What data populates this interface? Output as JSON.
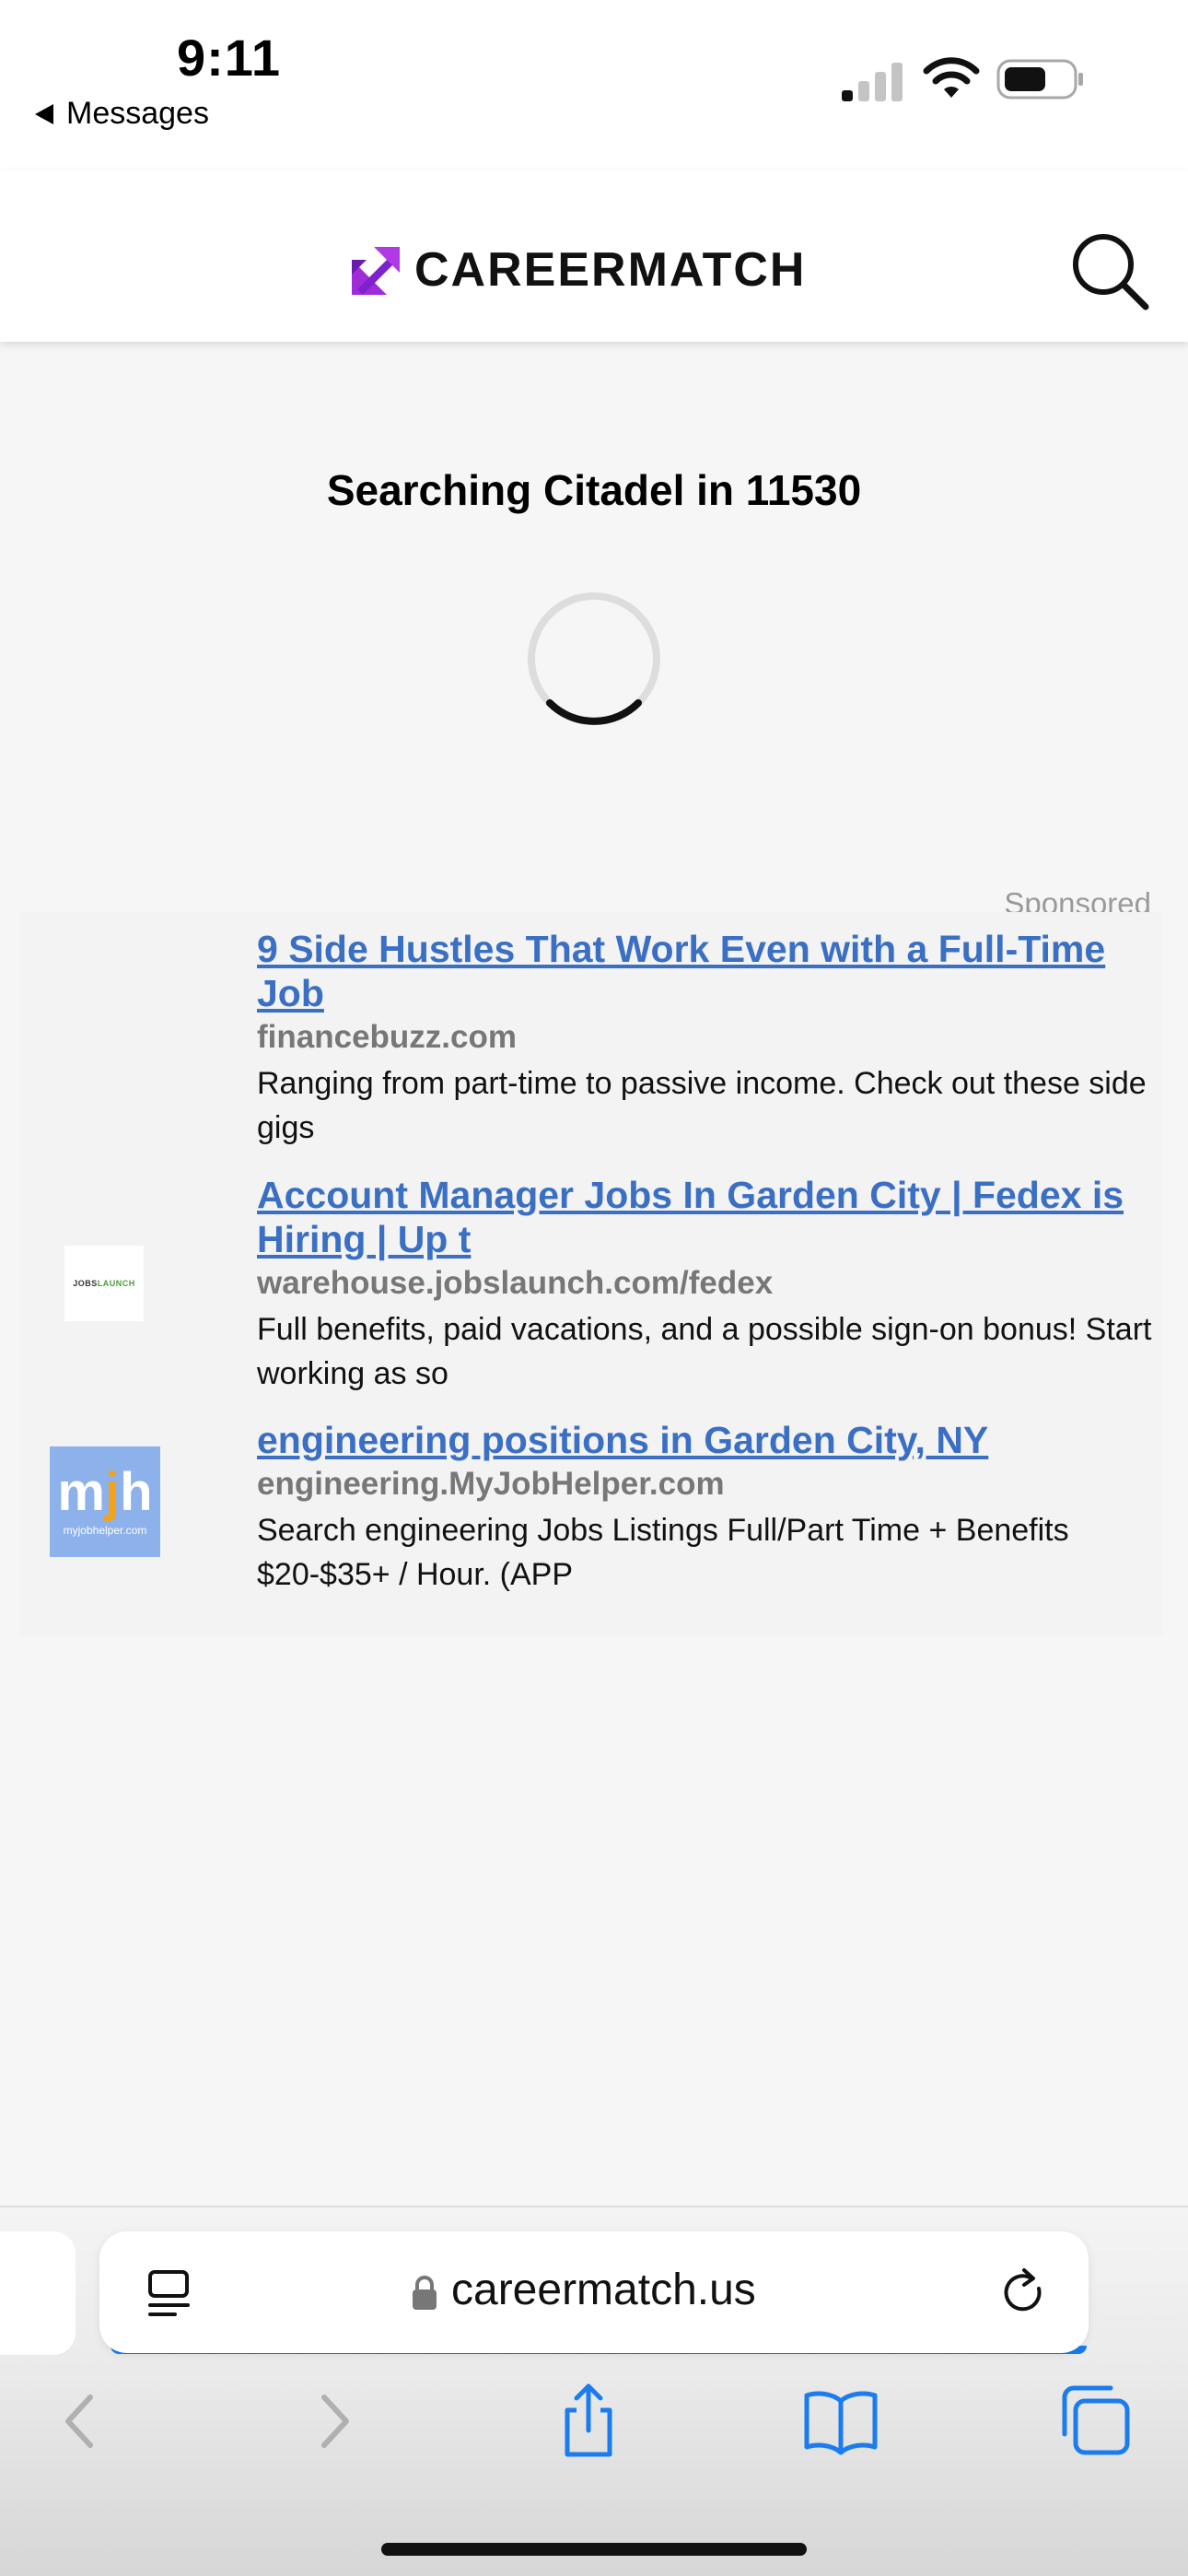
{
  "status_bar": {
    "time": "9:11",
    "back_app_label": "Messages"
  },
  "header": {
    "logo_text": "CAREERMATCH"
  },
  "main": {
    "searching_text": "Searching Citadel in 11530"
  },
  "ads": {
    "label": "Sponsored",
    "items": [
      {
        "title": "9 Side Hustles That Work Even with a Full-Time Job",
        "domain": "financebuzz.com",
        "description": "Ranging from part-time to passive income. Check out these side gigs"
      },
      {
        "title": "Account Manager Jobs In Garden City | Fedex is Hiring | Up t",
        "domain": "warehouse.jobslaunch.com/fedex",
        "description": "Full benefits, paid vacations, and a possible sign-on bonus! Start working as so",
        "thumb_text": "JOBSLAUNCH"
      },
      {
        "title": "engineering positions in Garden City, NY",
        "domain": "engineering.MyJobHelper.com",
        "description": "Search engineering Jobs Listings Full/Part Time + Benefits $20-$35+ / Hour. (APP",
        "thumb_text": "mjh",
        "thumb_subtext": "myjobhelper.com"
      }
    ]
  },
  "browser": {
    "url": "careermatch.us",
    "accent_color": "#1a7cf0"
  },
  "colors": {
    "link": "#3a6fc4",
    "logo_arrow": "#a02bd8",
    "page_bg": "#f6f6f6"
  }
}
